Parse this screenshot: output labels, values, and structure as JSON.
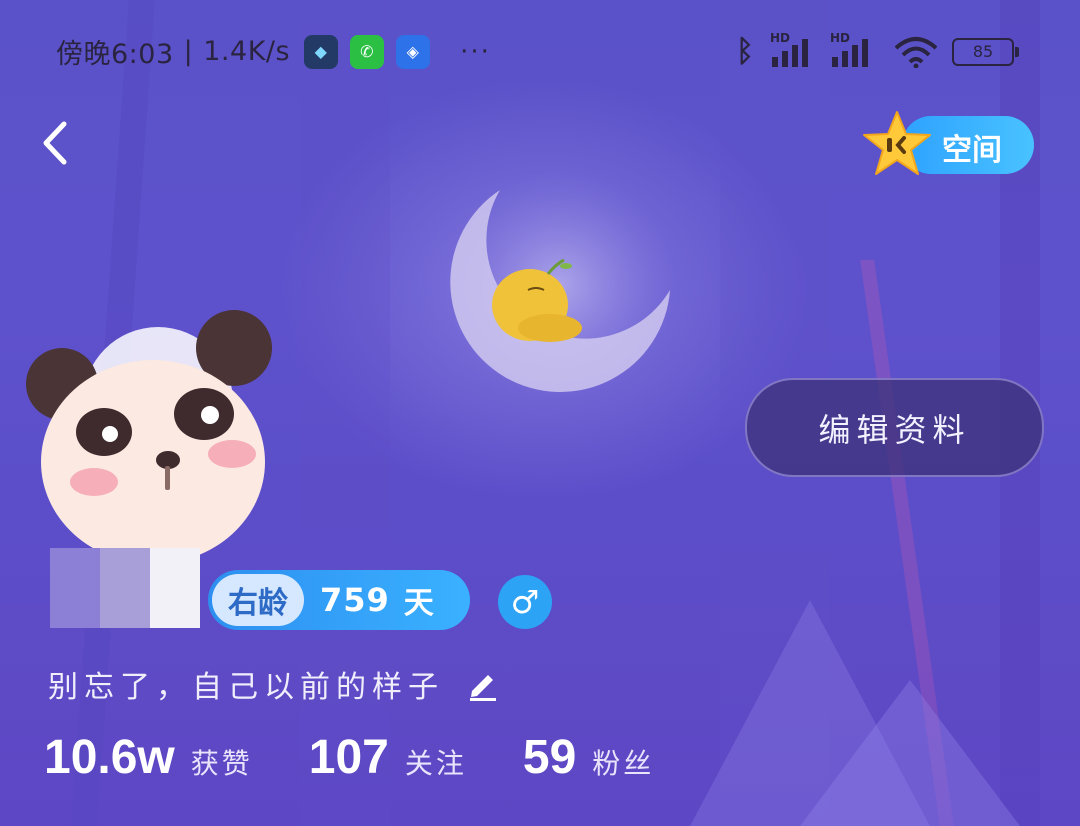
{
  "status_bar": {
    "time": "傍晚6:03",
    "speed": "1.4K/s",
    "app_icons": [
      "map-app-icon",
      "wechat-icon",
      "gov-app-icon"
    ],
    "more": "···",
    "signal_label_1": "HD",
    "signal_label_2": "HD",
    "battery": "85"
  },
  "nav": {
    "space_label": "空间"
  },
  "profile": {
    "edit_label": "编辑资料",
    "age_tag": "右龄",
    "age_days": "759",
    "age_unit": "天",
    "gender_symbol": "♂",
    "signature": "别忘了，自己以前的样子",
    "stats": [
      {
        "value": "10.6w",
        "label": "获赞"
      },
      {
        "value": "107",
        "label": "关注"
      },
      {
        "value": "59",
        "label": "粉丝"
      }
    ]
  },
  "colors": {
    "accent_blue": "#3ab1ff",
    "background_purple": "#5c4ec9"
  }
}
